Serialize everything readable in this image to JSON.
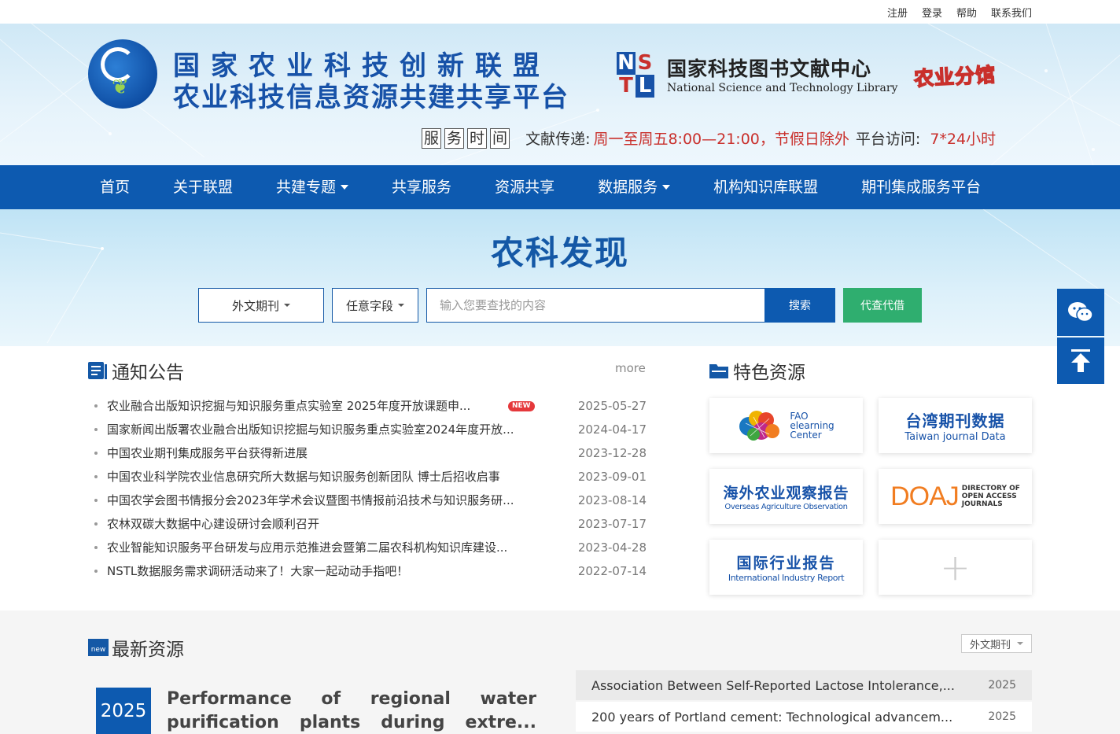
{
  "toplinks": [
    "注册",
    "登录",
    "帮助",
    "联系我们"
  ],
  "header": {
    "title_main": "国家农业科技创新联盟",
    "title_sub": "农业科技信息资源共建共享平台",
    "nstl_letters": [
      "N",
      "S",
      "T",
      "L"
    ],
    "nstl_cn": "国家科技图书文献中心",
    "nstl_en": "National Science and Technology Library",
    "branch": "农业分馆",
    "service_chars": [
      "服",
      "务",
      "时",
      "间"
    ],
    "delivery_label": "文献传递:",
    "delivery_time": "周一至周五8:00—21:00，节假日除外",
    "access_label": "平台访问:",
    "access_time": "7*24小时"
  },
  "nav": {
    "items": [
      {
        "label": "首页",
        "dropdown": false
      },
      {
        "label": "关于联盟",
        "dropdown": false
      },
      {
        "label": "共建专题",
        "dropdown": true
      },
      {
        "label": "共享服务",
        "dropdown": false
      },
      {
        "label": "资源共享",
        "dropdown": false
      },
      {
        "label": "数据服务",
        "dropdown": true
      },
      {
        "label": "机构知识库联盟",
        "dropdown": false
      },
      {
        "label": "期刊集成服务平台",
        "dropdown": false
      }
    ]
  },
  "search": {
    "title": "农科发现",
    "scope": "外文期刊",
    "field": "任意字段",
    "placeholder": "输入您要查找的内容",
    "search_label": "搜索",
    "proxy_label": "代查代借"
  },
  "notice": {
    "title": "通知公告",
    "more": "more",
    "new_badge": "NEW",
    "items": [
      {
        "title": "农业融合出版知识挖掘与知识服务重点实验室 2025年度开放课题申...",
        "date": "2025-05-27",
        "is_new": true
      },
      {
        "title": "国家新闻出版署农业融合出版知识挖掘与知识服务重点实验室2024年度开放...",
        "date": "2024-04-17",
        "is_new": false
      },
      {
        "title": "中国农业期刊集成服务平台获得新进展",
        "date": "2023-12-28",
        "is_new": false
      },
      {
        "title": "中国农业科学院农业信息研究所大数据与知识服务创新团队 博士后招收启事",
        "date": "2023-09-01",
        "is_new": false
      },
      {
        "title": "中国农学会图书情报分会2023年学术会议暨图书情报前沿技术与知识服务研...",
        "date": "2023-08-14",
        "is_new": false
      },
      {
        "title": "农林双碳大数据中心建设研讨会顺利召开",
        "date": "2023-07-17",
        "is_new": false
      },
      {
        "title": "农业智能知识服务平台研发与应用示范推进会暨第二届农科机构知识库建设...",
        "date": "2023-04-28",
        "is_new": false
      },
      {
        "title": "NSTL数据服务需求调研活动来了！大家一起动动手指吧！",
        "date": "2022-07-14",
        "is_new": false
      }
    ]
  },
  "featured": {
    "title": "特色资源",
    "fao": {
      "line1": "FAO",
      "line2": "elearning",
      "line3": "Center"
    },
    "taiwan": {
      "cn": "台湾期刊数据",
      "en": "Taiwan journal Data"
    },
    "overseas": {
      "cn": "海外农业观察报告",
      "en": "Overseas Agriculture Observation"
    },
    "doaj": {
      "logo": "DOAJ",
      "line1": "DIRECTORY OF",
      "line2": "OPEN ACCESS",
      "line3": "JOURNALS"
    },
    "industry": {
      "cn": "国际行业报告",
      "en": "International Industry Report"
    },
    "more_symbol": "+"
  },
  "latest": {
    "title": "最新资源",
    "icon_text": "new",
    "filter": "外文期刊",
    "featured_year": "2025",
    "featured_title": "Performance of regional water purification plants during extre...",
    "items": [
      {
        "title": "Association Between Self-Reported Lactose Intolerance,...",
        "year": "2025"
      },
      {
        "title": "200 years of Portland cement: Technological advancem...",
        "year": "2025"
      }
    ]
  },
  "colors": {
    "primary": "#0d5ab0",
    "accent_red": "#c9302c",
    "green": "#2fae6f"
  }
}
